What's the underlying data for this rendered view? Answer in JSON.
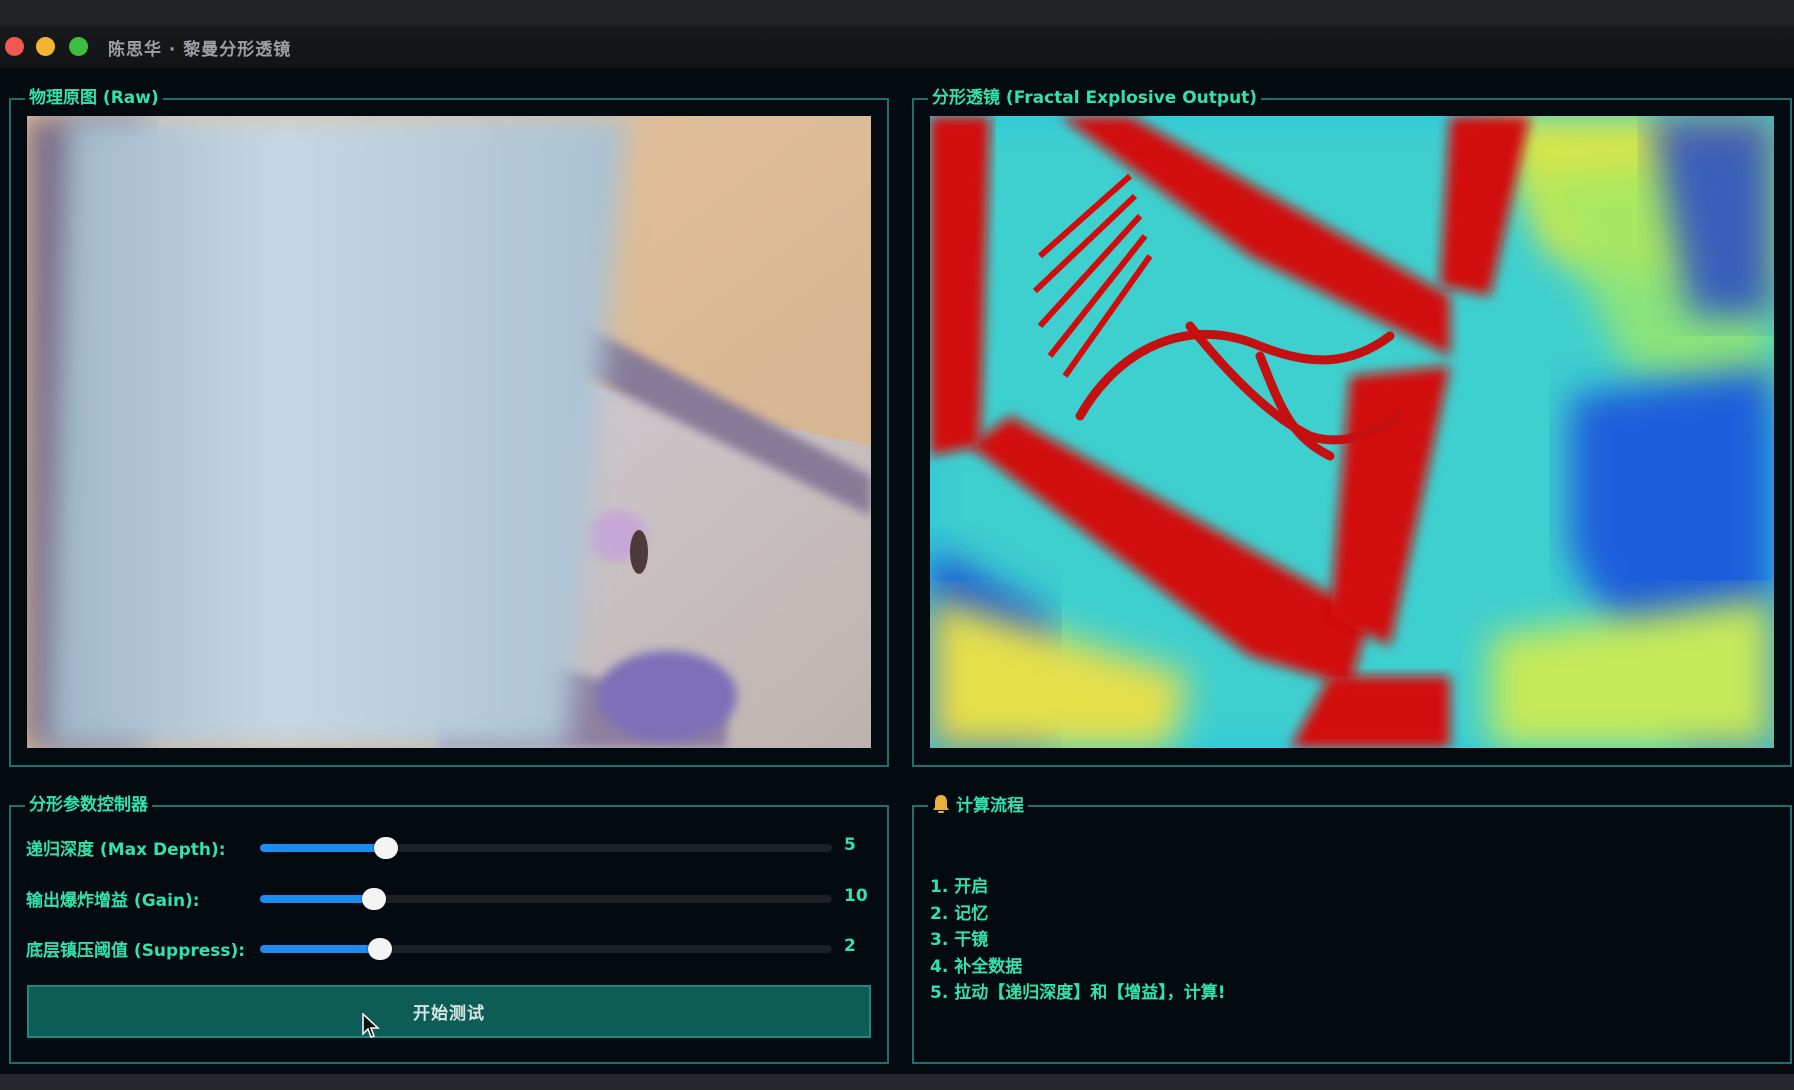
{
  "window": {
    "title": "陈思华 · 黎曼分形透镜"
  },
  "panels": {
    "raw": {
      "title": "物理原图 (Raw)"
    },
    "fractal": {
      "title": "分形透镜 (Fractal Explosive Output)"
    }
  },
  "controls": {
    "title": "分形参数控制器",
    "sliders": [
      {
        "label": "递归深度 (Max Depth):",
        "value": "5",
        "fraction": 0.22
      },
      {
        "label": "输出爆炸增益 (Gain):",
        "value": "10",
        "fraction": 0.2
      },
      {
        "label": "底层镇压阈值 (Suppress):",
        "value": "2",
        "fraction": 0.21
      }
    ],
    "start_button": "开始测试"
  },
  "process": {
    "title": "计算流程",
    "icon": "bell-icon",
    "steps": [
      "1. 开启",
      "2. 记忆",
      "3. 干镜",
      "4. 补全数据",
      "5. 拉动【递归深度】和【增益】，计算!"
    ]
  },
  "colors": {
    "accent_text": "#32e2aa",
    "panel_border": "#1f6f6d",
    "button_bg": "#0e5c56",
    "slider_fill": "#1d8cf0",
    "background": "#030a10"
  }
}
